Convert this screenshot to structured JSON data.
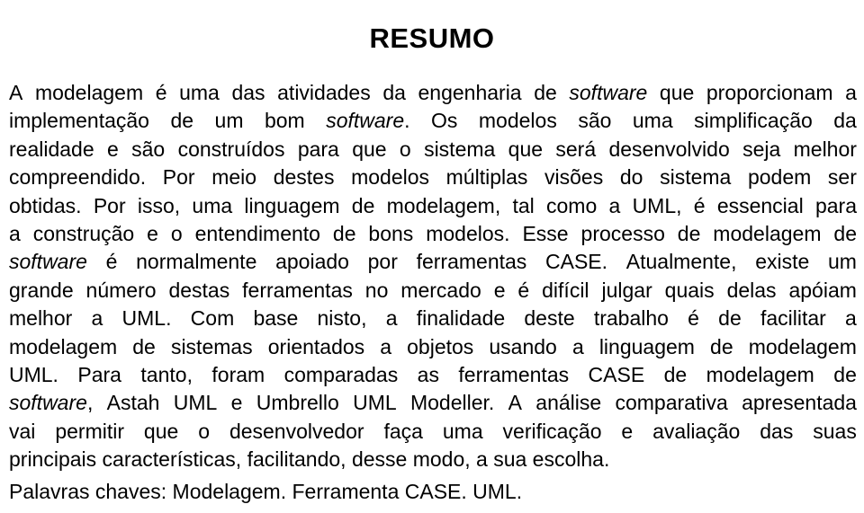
{
  "document": {
    "title": "RESUMO",
    "language": "pt-BR",
    "abstract_lines": [
      {
        "id": 1,
        "justified": true,
        "words": [
          "A",
          "modelagem",
          "é",
          "uma",
          "das",
          "atividades",
          "da",
          "engenharia",
          "de",
          "software",
          "que",
          "proporcionam",
          "a"
        ],
        "italic_words": [
          "software"
        ],
        "text": "A modelagem é uma das atividades da engenharia de software que proporcionam a"
      },
      {
        "id": 2,
        "justified": true,
        "words": [
          "implementação",
          "de",
          "um",
          "bom",
          "software.",
          "Os",
          "modelos",
          "são",
          "uma",
          "simplificação",
          "da"
        ],
        "italic_words": [
          "software"
        ],
        "text": "implementação de um bom software. Os modelos são uma simplificação da"
      },
      {
        "id": 3,
        "justified": true,
        "words": [
          "realidade",
          "e",
          "são",
          "construídos",
          "para",
          "que",
          "o",
          "sistema",
          "que",
          "será",
          "desenvolvido",
          "seja",
          "melhor"
        ],
        "italic_words": [],
        "text": "realidade e são construídos para que o sistema que será desenvolvido seja melhor"
      },
      {
        "id": 4,
        "justified": true,
        "words": [
          "compreendido.",
          "Por",
          "meio",
          "destes",
          "modelos",
          "múltiplas",
          "visões",
          "do",
          "sistema",
          "podem",
          "ser"
        ],
        "italic_words": [],
        "text": "compreendido. Por meio destes modelos múltiplas visões do sistema podem ser"
      },
      {
        "id": 5,
        "justified": true,
        "words": [
          "obtidas.",
          "Por",
          "isso,",
          "uma",
          "linguagem",
          "de",
          "modelagem,",
          "tal",
          "como",
          "a",
          "UML,",
          "é",
          "essencial",
          "para"
        ],
        "italic_words": [],
        "text": "obtidas. Por isso, uma linguagem de modelagem, tal como a UML, é essencial para"
      },
      {
        "id": 6,
        "justified": true,
        "words": [
          "a",
          "construção",
          "e",
          "o",
          "entendimento",
          "de",
          "bons",
          "modelos.",
          "Esse",
          "processo",
          "de",
          "modelagem",
          "de"
        ],
        "italic_words": [],
        "text": "a construção e o entendimento de bons modelos. Esse processo de modelagem de"
      },
      {
        "id": 7,
        "justified": true,
        "words": [
          "software",
          "é",
          "normalmente",
          "apoiado",
          "por",
          "ferramentas",
          "CASE.",
          "Atualmente,",
          "existe",
          "um"
        ],
        "italic_words": [
          "software"
        ],
        "text": "software é normalmente apoiado por ferramentas CASE. Atualmente, existe um"
      },
      {
        "id": 8,
        "justified": true,
        "words": [
          "grande",
          "número",
          "destas",
          "ferramentas",
          "no",
          "mercado",
          "e",
          "é",
          "difícil",
          "julgar",
          "quais",
          "delas",
          "apóiam"
        ],
        "italic_words": [],
        "text": "grande número destas ferramentas no mercado e é difícil julgar quais delas apóiam"
      },
      {
        "id": 9,
        "justified": true,
        "words": [
          "melhor",
          "a",
          "UML.",
          "Com",
          "base",
          "nisto,",
          "a",
          "finalidade",
          "deste",
          "trabalho",
          "é",
          "de",
          "facilitar",
          "a"
        ],
        "italic_words": [],
        "text": "melhor a UML. Com base nisto, a finalidade deste trabalho é de facilitar a"
      },
      {
        "id": 10,
        "justified": true,
        "words": [
          "modelagem",
          "de",
          "sistemas",
          "orientados",
          "a",
          "objetos",
          "usando",
          "a",
          "linguagem",
          "de",
          "modelagem"
        ],
        "italic_words": [],
        "text": "modelagem de sistemas orientados a objetos usando a linguagem de modelagem"
      },
      {
        "id": 11,
        "justified": true,
        "words": [
          "UML.",
          "Para",
          "tanto,",
          "foram",
          "comparadas",
          "as",
          "ferramentas",
          "CASE",
          "de",
          "modelagem",
          "de"
        ],
        "italic_words": [],
        "text": "UML. Para tanto, foram comparadas as ferramentas CASE de modelagem de"
      },
      {
        "id": 12,
        "justified": true,
        "words": [
          "software,",
          "Astah",
          "UML",
          "e",
          "Umbrello",
          "UML",
          "Modeller.",
          "A",
          "análise",
          "comparativa",
          "apresentada"
        ],
        "italic_words": [
          "software"
        ],
        "text": "software, Astah UML e Umbrello UML Modeller. A análise comparativa apresentada"
      },
      {
        "id": 13,
        "justified": true,
        "words": [
          "vai",
          "permitir",
          "que",
          "o",
          "desenvolvedor",
          "faça",
          "uma",
          "verificação",
          "e",
          "avaliação",
          "das",
          "suas"
        ],
        "italic_words": [],
        "text": "vai permitir que o desenvolvedor faça uma verificação e avaliação das suas"
      },
      {
        "id": 14,
        "justified": false,
        "words": [
          "principais",
          "características,",
          "facilitando,",
          "desse",
          "modo,",
          "a",
          "sua",
          "escolha."
        ],
        "italic_words": [],
        "text": "principais características, facilitando, desse modo, a sua escolha."
      }
    ],
    "keywords_label": "Palavras chaves:",
    "keywords_values": "Modelagem. Ferramenta CASE. UML.",
    "keywords_full": "Palavras chaves: Modelagem. Ferramenta CASE. UML."
  },
  "colors": {
    "background": "#ffffff",
    "text": "#000000"
  }
}
